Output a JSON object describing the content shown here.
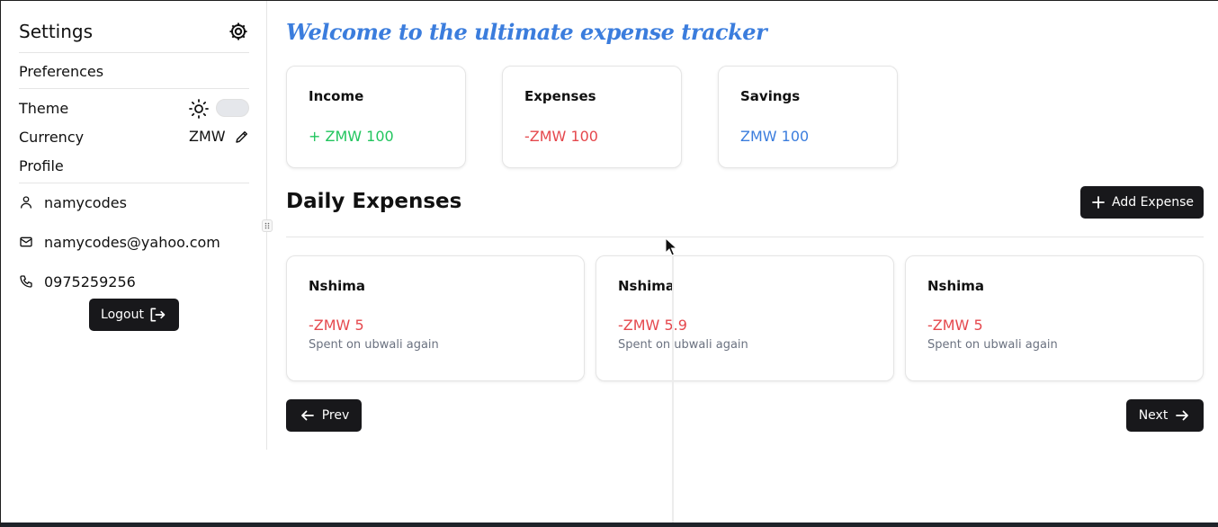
{
  "sidebar": {
    "title": "Settings",
    "preferences_label": "Preferences",
    "theme_label": "Theme",
    "currency_label": "Currency",
    "currency_value": "ZMW",
    "profile_label": "Profile",
    "username": "namycodes",
    "email": "namycodes@yahoo.com",
    "phone": "0975259256",
    "logout_label": "Logout"
  },
  "main": {
    "welcome": "Welcome to the ultimate expense tracker",
    "stats": [
      {
        "title": "Income",
        "value": "+ ZMW 100",
        "color": "#22c55e"
      },
      {
        "title": "Expenses",
        "value": "-ZMW 100",
        "color": "#e5484d"
      },
      {
        "title": "Savings",
        "value": "ZMW 100",
        "color": "#3b7ddd"
      }
    ],
    "section_title": "Daily Expenses",
    "add_button": "Add Expense",
    "expenses": [
      {
        "title": "Nshima",
        "amount": "-ZMW 5",
        "description": "Spent on ubwali again"
      },
      {
        "title": "Nshima",
        "amount": "-ZMW 5.9",
        "description": "Spent on ubwali again"
      },
      {
        "title": "Nshima",
        "amount": "-ZMW 5",
        "description": "Spent on ubwali again"
      }
    ],
    "prev_label": "Prev",
    "next_label": "Next"
  },
  "icons": {
    "settings": "gear-icon",
    "theme": "sun-icon",
    "edit": "pencil-icon",
    "user": "user-icon",
    "email": "mail-icon",
    "phone": "phone-icon",
    "logout": "logout-icon",
    "add": "plus-icon",
    "prev": "arrow-left-icon",
    "next": "arrow-right-icon"
  }
}
